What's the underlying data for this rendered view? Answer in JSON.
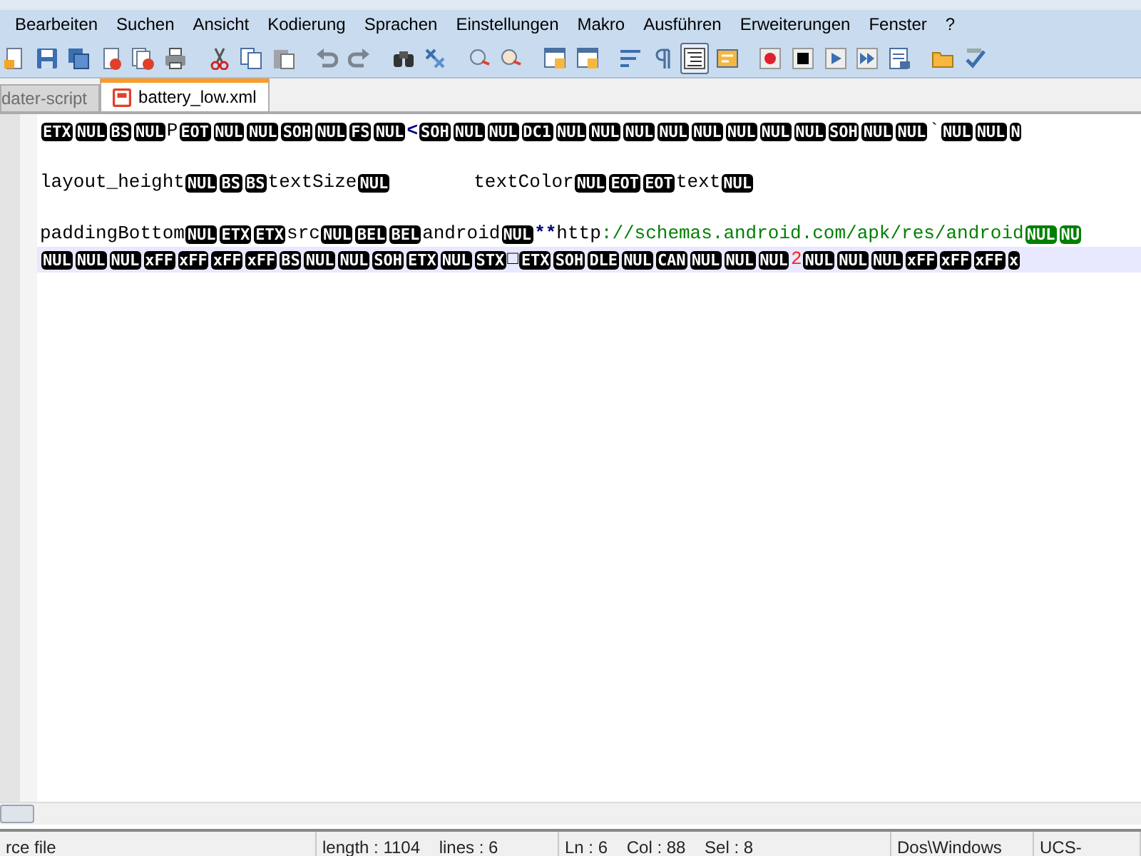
{
  "menu": [
    "Bearbeiten",
    "Suchen",
    "Ansicht",
    "Kodierung",
    "Sprachen",
    "Einstellungen",
    "Makro",
    "Ausführen",
    "Erweiterungen",
    "Fenster",
    "?"
  ],
  "toolbar": [
    {
      "kind": "new",
      "pressed": false
    },
    {
      "kind": "save",
      "pressed": false
    },
    {
      "kind": "saveall",
      "pressed": false
    },
    {
      "kind": "close",
      "pressed": false
    },
    {
      "kind": "closeall",
      "pressed": false
    },
    {
      "kind": "print",
      "pressed": false
    },
    {
      "kind": "sep"
    },
    {
      "kind": "cut",
      "pressed": false
    },
    {
      "kind": "copy",
      "pressed": false
    },
    {
      "kind": "paste",
      "pressed": false
    },
    {
      "kind": "sep"
    },
    {
      "kind": "undo",
      "pressed": false
    },
    {
      "kind": "redo",
      "pressed": false
    },
    {
      "kind": "sep"
    },
    {
      "kind": "find",
      "pressed": false
    },
    {
      "kind": "replace",
      "pressed": false
    },
    {
      "kind": "sep"
    },
    {
      "kind": "zoomin",
      "pressed": false
    },
    {
      "kind": "zoomout",
      "pressed": false
    },
    {
      "kind": "sep"
    },
    {
      "kind": "window",
      "pressed": false
    },
    {
      "kind": "window",
      "pressed": false
    },
    {
      "kind": "sep"
    },
    {
      "kind": "wrap",
      "pressed": false
    },
    {
      "kind": "pilcrow",
      "pressed": false
    },
    {
      "kind": "lines",
      "pressed": true
    },
    {
      "kind": "panel",
      "pressed": false
    },
    {
      "kind": "sep"
    },
    {
      "kind": "record",
      "pressed": false
    },
    {
      "kind": "stop",
      "pressed": false
    },
    {
      "kind": "play",
      "pressed": false
    },
    {
      "kind": "playmulti",
      "pressed": false
    },
    {
      "kind": "savemacro",
      "pressed": false
    },
    {
      "kind": "sep"
    },
    {
      "kind": "folder",
      "pressed": false
    },
    {
      "kind": "spell",
      "pressed": false
    }
  ],
  "tabs": [
    {
      "label": "dater-script",
      "selected": false
    },
    {
      "label": "battery_low.xml",
      "selected": true
    }
  ],
  "lines": [
    {
      "current": false,
      "tokens": [
        {
          "kind": "ctrl",
          "text": "ETX"
        },
        {
          "kind": "ctrl",
          "text": "NUL"
        },
        {
          "kind": "ctrl",
          "text": "BS"
        },
        {
          "kind": "ctrl",
          "text": "NUL"
        },
        {
          "kind": "text",
          "text": "P"
        },
        {
          "kind": "ctrl",
          "text": "EOT"
        },
        {
          "kind": "ctrl",
          "text": "NUL"
        },
        {
          "kind": "ctrl",
          "text": "NUL"
        },
        {
          "kind": "ctrl",
          "text": "SOH"
        },
        {
          "kind": "ctrl",
          "text": "NUL"
        },
        {
          "kind": "ctrl",
          "text": "FS"
        },
        {
          "kind": "ctrl",
          "text": "NUL"
        },
        {
          "kind": "operator",
          "text": "<"
        },
        {
          "kind": "ctrl",
          "text": "SOH"
        },
        {
          "kind": "ctrl",
          "text": "NUL"
        },
        {
          "kind": "ctrl",
          "text": "NUL"
        },
        {
          "kind": "ctrl",
          "text": "DC1"
        },
        {
          "kind": "ctrl",
          "text": "NUL"
        },
        {
          "kind": "ctrl",
          "text": "NUL"
        },
        {
          "kind": "ctrl",
          "text": "NUL"
        },
        {
          "kind": "ctrl",
          "text": "NUL"
        },
        {
          "kind": "ctrl",
          "text": "NUL"
        },
        {
          "kind": "ctrl",
          "text": "NUL"
        },
        {
          "kind": "ctrl",
          "text": "NUL"
        },
        {
          "kind": "ctrl",
          "text": "NUL"
        },
        {
          "kind": "ctrl",
          "text": "SOH"
        },
        {
          "kind": "ctrl",
          "text": "NUL"
        },
        {
          "kind": "ctrl",
          "text": "NUL"
        },
        {
          "kind": "text",
          "text": "`"
        },
        {
          "kind": "ctrl",
          "text": "NUL"
        },
        {
          "kind": "ctrl",
          "text": "NUL"
        },
        {
          "kind": "ctrl",
          "text": "N"
        }
      ]
    },
    {
      "current": false
    },
    {
      "current": false,
      "tokens": [
        {
          "kind": "text",
          "text": "layout_height"
        },
        {
          "kind": "ctrl",
          "text": "NUL"
        },
        {
          "kind": "ctrl",
          "text": "BS"
        },
        {
          "kind": "ctrl",
          "text": "BS"
        },
        {
          "kind": "text",
          "text": "textSize"
        },
        {
          "kind": "ctrl",
          "text": "NUL"
        },
        {
          "kind": "tab"
        },
        {
          "kind": "text",
          "text": "textColor"
        },
        {
          "kind": "ctrl",
          "text": "NUL"
        },
        {
          "kind": "ctrl",
          "text": "EOT"
        },
        {
          "kind": "ctrl",
          "text": "EOT"
        },
        {
          "kind": "text",
          "text": "text"
        },
        {
          "kind": "ctrl",
          "text": "NUL"
        }
      ]
    },
    {
      "current": false
    },
    {
      "current": false,
      "tokens": [
        {
          "kind": "text",
          "text": "paddingBottom"
        },
        {
          "kind": "ctrl",
          "text": "NUL"
        },
        {
          "kind": "ctrl",
          "text": "ETX"
        },
        {
          "kind": "ctrl",
          "text": "ETX"
        },
        {
          "kind": "text",
          "text": "src"
        },
        {
          "kind": "ctrl",
          "text": "NUL"
        },
        {
          "kind": "ctrl",
          "text": "BEL"
        },
        {
          "kind": "ctrl",
          "text": "BEL"
        },
        {
          "kind": "text",
          "text": "android"
        },
        {
          "kind": "ctrl",
          "text": "NUL"
        },
        {
          "kind": "operator",
          "text": "**"
        },
        {
          "kind": "text",
          "text": "http"
        },
        {
          "kind": "string",
          "text": "://schemas.android.com/apk/res/android"
        },
        {
          "kind": "ctrl-string",
          "text": "NUL"
        },
        {
          "kind": "ctrl-string",
          "text": "NU"
        }
      ]
    },
    {
      "current": true,
      "tokens": [
        {
          "kind": "ctrl",
          "text": "NUL"
        },
        {
          "kind": "ctrl",
          "text": "NUL"
        },
        {
          "kind": "ctrl",
          "text": "NUL"
        },
        {
          "kind": "ctrl",
          "text": "xFF"
        },
        {
          "kind": "ctrl",
          "text": "xFF"
        },
        {
          "kind": "ctrl",
          "text": "xFF"
        },
        {
          "kind": "ctrl",
          "text": "xFF"
        },
        {
          "kind": "ctrl",
          "text": "BS"
        },
        {
          "kind": "ctrl",
          "text": "NUL"
        },
        {
          "kind": "ctrl",
          "text": "NUL"
        },
        {
          "kind": "ctrl",
          "text": "SOH"
        },
        {
          "kind": "ctrl",
          "text": "ETX"
        },
        {
          "kind": "ctrl",
          "text": "NUL"
        },
        {
          "kind": "ctrl",
          "text": "STX"
        },
        {
          "kind": "text",
          "text": "□"
        },
        {
          "kind": "ctrl",
          "text": "ETX"
        },
        {
          "kind": "ctrl",
          "text": "SOH"
        },
        {
          "kind": "ctrl",
          "text": "DLE"
        },
        {
          "kind": "ctrl",
          "text": "NUL"
        },
        {
          "kind": "ctrl",
          "text": "CAN"
        },
        {
          "kind": "ctrl",
          "text": "NUL"
        },
        {
          "kind": "ctrl",
          "text": "NUL"
        },
        {
          "kind": "ctrl",
          "text": "NUL"
        },
        {
          "kind": "number",
          "text": "2"
        },
        {
          "kind": "ctrl",
          "text": "NUL"
        },
        {
          "kind": "ctrl",
          "text": "NUL"
        },
        {
          "kind": "ctrl",
          "text": "NUL"
        },
        {
          "kind": "ctrl",
          "text": "xFF"
        },
        {
          "kind": "ctrl",
          "text": "xFF"
        },
        {
          "kind": "ctrl",
          "text": "xFF"
        },
        {
          "kind": "ctrl",
          "text": "x"
        }
      ]
    }
  ],
  "status_bar": [
    "rce file",
    "length : 1104    lines : 6",
    "Ln : 6    Col : 88    Sel : 8",
    "Dos\\Windows",
    "UCS-"
  ]
}
